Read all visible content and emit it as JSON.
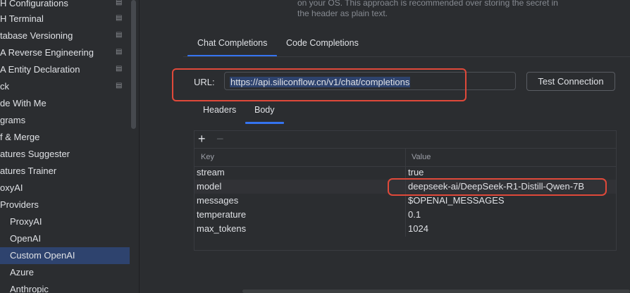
{
  "sidebar": {
    "items": [
      {
        "label": "H Configurations",
        "page_icon": true
      },
      {
        "label": "H Terminal",
        "page_icon": true
      },
      {
        "label": "tabase Versioning",
        "page_icon": true
      },
      {
        "label": "A Reverse Engineering",
        "page_icon": true
      },
      {
        "label": "A Entity Declaration",
        "page_icon": true
      },
      {
        "label": "ck",
        "page_icon": true
      },
      {
        "label": "de With Me",
        "page_icon": false
      },
      {
        "label": "grams",
        "page_icon": false
      },
      {
        "label": "f & Merge",
        "page_icon": false
      },
      {
        "label": "atures Suggester",
        "page_icon": false
      },
      {
        "label": "atures Trainer",
        "page_icon": false
      },
      {
        "label": "oxyAI",
        "page_icon": false
      },
      {
        "label": "Providers",
        "page_icon": false
      },
      {
        "label": "ProxyAI",
        "page_icon": false
      },
      {
        "label": "OpenAI",
        "page_icon": false
      },
      {
        "label": "Custom OpenAI",
        "page_icon": false
      },
      {
        "label": "Azure",
        "page_icon": false
      },
      {
        "label": "Anthropic",
        "page_icon": false
      }
    ],
    "selected": "Custom OpenAI"
  },
  "description": {
    "line1": "on your OS. This approach is recommended over storing the secret in",
    "line2": "the header as plain text."
  },
  "completion_tabs": {
    "chat": "Chat Completions",
    "code": "Code Completions",
    "active": "Chat Completions"
  },
  "url": {
    "label": "URL:",
    "value": "https://api.siliconflow.cn/v1/chat/completions"
  },
  "test_connection_label": "Test Connection",
  "request_tabs": {
    "headers": "Headers",
    "body": "Body",
    "active": "Body"
  },
  "body_table": {
    "add_icon": "plus-icon",
    "remove_icon": "minus-icon",
    "columns": [
      "Key",
      "Value"
    ],
    "rows": [
      {
        "key": "stream",
        "value": "true"
      },
      {
        "key": "model",
        "value": "deepseek-ai/DeepSeek-R1-Distill-Qwen-7B"
      },
      {
        "key": "messages",
        "value": "$OPENAI_MESSAGES"
      },
      {
        "key": "temperature",
        "value": "0.1"
      },
      {
        "key": "max_tokens",
        "value": "1024"
      }
    ]
  },
  "colors": {
    "accent": "#3574f0",
    "highlight_outline": "#e0493a",
    "selection": "#2e436e"
  }
}
